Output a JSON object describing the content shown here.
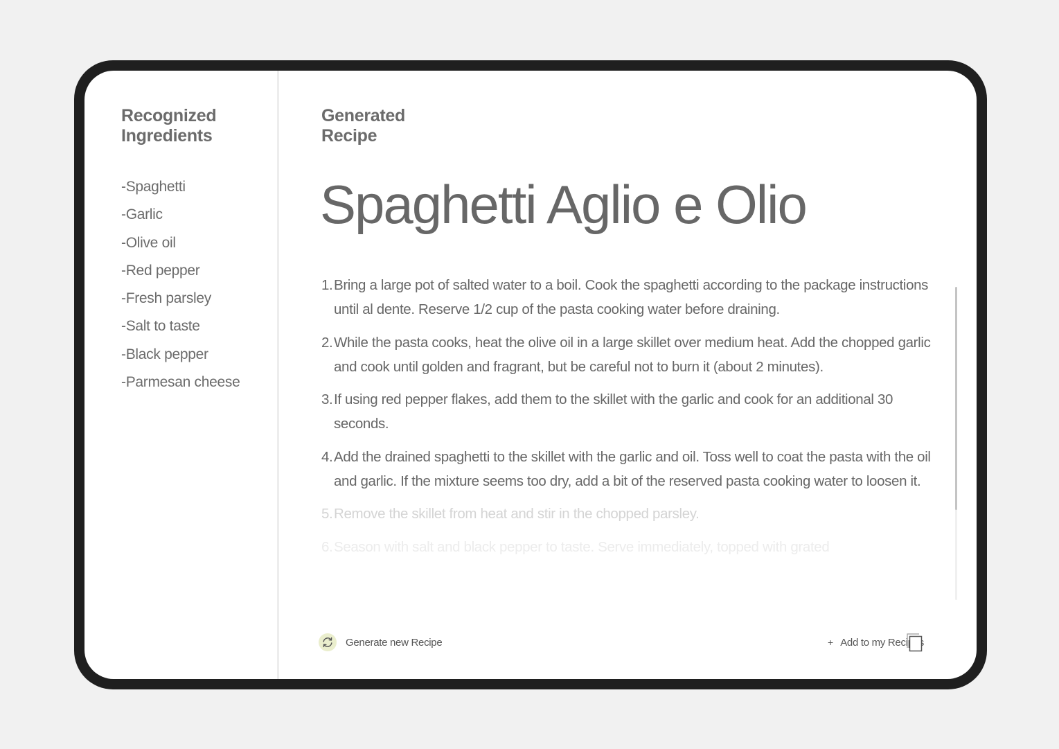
{
  "sidebar": {
    "heading_line1": "Recognized",
    "heading_line2": "Ingredients",
    "ingredients": [
      "-Spaghetti",
      "-Garlic",
      "-Olive oil",
      "-Red pepper",
      "-Fresh parsley",
      "-Salt to taste",
      "-Black pepper",
      "-Parmesan cheese"
    ]
  },
  "main": {
    "heading_line1": "Generated",
    "heading_line2": "Recipe",
    "recipe_title": "Spaghetti Aglio e Olio",
    "steps": [
      {
        "num": "1.",
        "text": "Bring a large pot of salted water to a boil. Cook the spaghetti according to the package instructions until al dente. Reserve 1/2 cup of the pasta cooking water before draining."
      },
      {
        "num": "2.",
        "text": "While the pasta cooks, heat the olive oil in a large skillet over medium heat. Add the chopped garlic and cook until golden and fragrant, but be careful not to burn it (about 2 minutes)."
      },
      {
        "num": "3.",
        "text": "If using red pepper flakes, add them to the skillet with the garlic and cook for an additional 30 seconds."
      },
      {
        "num": "4.",
        "text": "Add the drained spaghetti to the skillet with the garlic and oil. Toss well to coat the pasta with the oil and garlic. If the mixture seems too dry, add a bit of the reserved pasta cooking water to loosen it."
      },
      {
        "num": "5.",
        "text": "Remove the skillet from heat and stir in the chopped parsley."
      },
      {
        "num": "6.",
        "text": "Season with salt and black pepper to taste. Serve immediately, topped with grated"
      }
    ]
  },
  "actions": {
    "generate_label": "Generate new Recipe",
    "add_plus": "+",
    "add_label": "Add to my Recipes"
  },
  "icons": {
    "refresh": "refresh-icon",
    "plus": "plus-icon",
    "copy": "copy-icon"
  },
  "colors": {
    "device_frame": "#1f1f1f",
    "background": "#f1f1f1",
    "text": "#676767",
    "refresh_accent": "#eaeecd",
    "faded_step_5": "#d4d4d4",
    "faded_step_6": "#ececec"
  }
}
